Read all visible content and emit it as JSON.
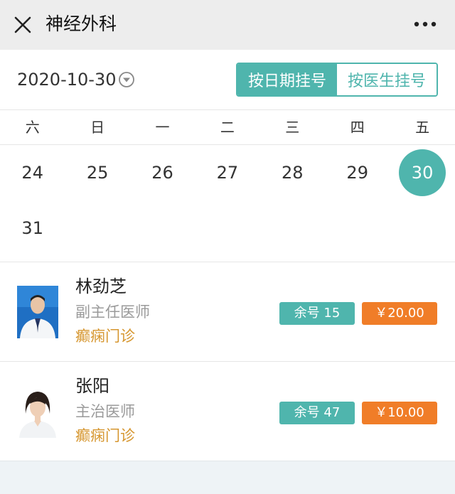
{
  "header": {
    "title": "神经外科",
    "close_icon": "close-icon",
    "more_icon": "more-dots-icon"
  },
  "datebar": {
    "date": "2020-10-30",
    "dropdown_icon": "chevron-down-circle-icon",
    "mode_by_date": "按日期挂号",
    "mode_by_doctor": "按医生挂号",
    "active_mode": "by_date"
  },
  "calendar": {
    "weekdays": [
      "六",
      "日",
      "一",
      "二",
      "三",
      "四",
      "五"
    ],
    "row1": [
      "24",
      "25",
      "26",
      "27",
      "28",
      "29",
      "30"
    ],
    "row2": [
      "31"
    ],
    "selected": "30"
  },
  "doctors": [
    {
      "name": "林劲芝",
      "title": "副主任医师",
      "clinic": "癫痫门诊",
      "remaining": "余号 15",
      "price": "￥20.00"
    },
    {
      "name": "张阳",
      "title": "主治医师",
      "clinic": "癫痫门诊",
      "remaining": "余号 47",
      "price": "￥10.00"
    }
  ],
  "colors": {
    "accent": "#4fb5ad",
    "price": "#f07d28",
    "clinic": "#d6962f"
  }
}
